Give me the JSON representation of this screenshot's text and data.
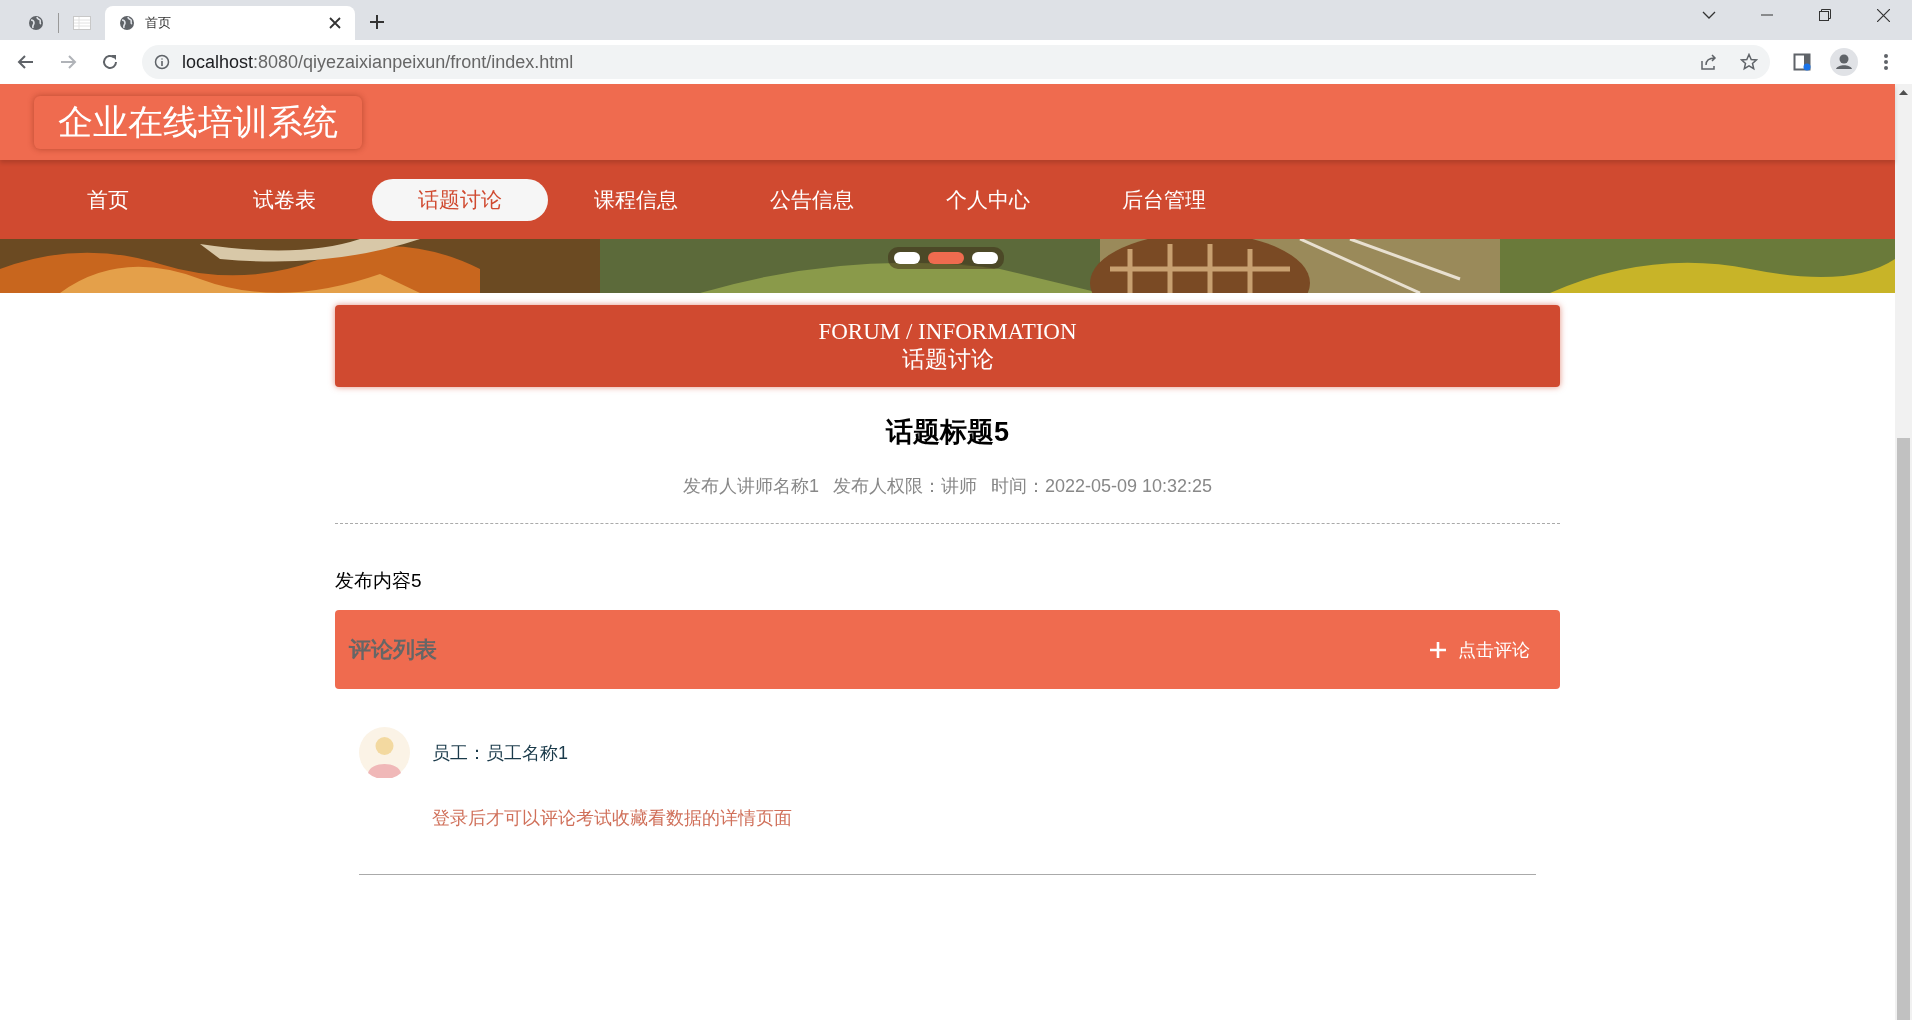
{
  "browser": {
    "tabs": [
      {
        "kind": "globe",
        "selected": false
      },
      {
        "kind": "sheet",
        "selected": false
      },
      {
        "kind": "globe",
        "title": "首页",
        "selected": true
      }
    ],
    "url": "localhost:8080/qiyezaixianpeixun/front/index.html"
  },
  "site": {
    "title": "企业在线培训系统",
    "nav": [
      {
        "label": "首页",
        "selected": false
      },
      {
        "label": "试卷表",
        "selected": false
      },
      {
        "label": "话题讨论",
        "selected": true
      },
      {
        "label": "课程信息",
        "selected": false
      },
      {
        "label": "公告信息",
        "selected": false
      },
      {
        "label": "个人中心",
        "selected": false
      },
      {
        "label": "后台管理",
        "selected": false
      }
    ],
    "banner": {
      "dots": [
        {
          "selected": false
        },
        {
          "selected": true
        },
        {
          "selected": false
        }
      ]
    }
  },
  "section": {
    "english": "FORUM / INFORMATION",
    "chinese": "话题讨论"
  },
  "topic": {
    "title": "话题标题5",
    "meta": [
      "发布人讲师名称1",
      "发布人权限：讲师",
      "时间：2022-05-09 10:32:25"
    ],
    "content": "发布内容5"
  },
  "comments": {
    "title": "评论列表",
    "action": "点击评论",
    "items": [
      {
        "author": "员工：员工名称1",
        "text": "登录后才可以评论考试收藏看数据的详情页面"
      }
    ]
  }
}
